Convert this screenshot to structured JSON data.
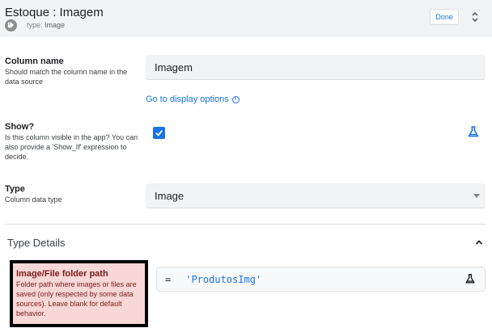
{
  "header": {
    "title": "Estoque : Imagem",
    "type_prefix": "type:",
    "type_value": "Image",
    "done_label": "Done"
  },
  "column_name": {
    "label": "Column name",
    "help": "Should match the column name in the data source",
    "value": "Imagem",
    "display_link": "Go to display options"
  },
  "show": {
    "label": "Show?",
    "help": "Is this column visible in the app? You can also provide a 'Show_If' expression to decide.",
    "checked": true
  },
  "type": {
    "label": "Type",
    "help": "Column data type",
    "selected": "Image"
  },
  "type_details": {
    "title": "Type Details",
    "folder_path": {
      "label": "Image/File folder path",
      "help": "Folder path where images or files are saved (only respected by some data sources). Leave blank for default behavior.",
      "expr_operator": "=",
      "expr_value": "'ProdutosImg'"
    }
  },
  "colors": {
    "accent": "#1a73e8",
    "highlight_bg": "#f8d7d7",
    "highlight_border": "#000000"
  }
}
